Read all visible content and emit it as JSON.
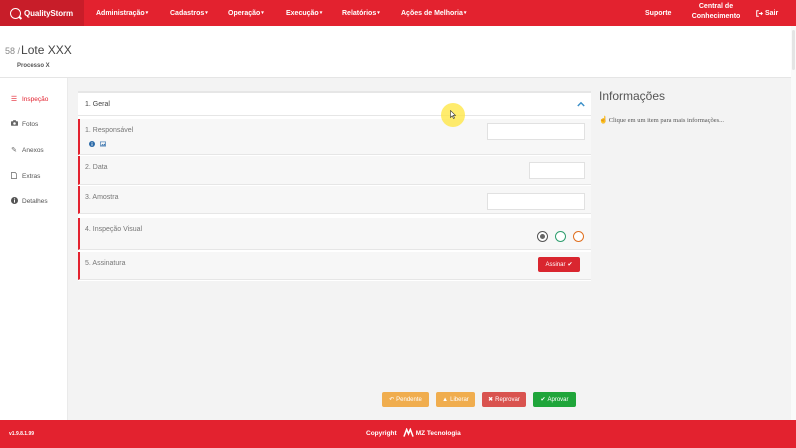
{
  "brand": {
    "name": "QualityStorm"
  },
  "nav": {
    "items": [
      {
        "label": "Administração"
      },
      {
        "label": "Cadastros"
      },
      {
        "label": "Operação"
      },
      {
        "label": "Execução"
      },
      {
        "label": "Relatórios"
      },
      {
        "label": "Ações de Melhoria"
      }
    ],
    "caret": "▾",
    "support": "Suporte",
    "knowledge_line1": "Central de",
    "knowledge_line2": "Conhecimento",
    "logout_icon": "sign-out-icon",
    "logout": "Sair"
  },
  "header": {
    "number": "58 /",
    "title": "Lote XXX",
    "subtitle": "Processo X"
  },
  "sidebar": {
    "items": [
      {
        "label": "Inspeção",
        "icon": "list-icon",
        "active": true
      },
      {
        "label": "Fotos",
        "icon": "camera-icon"
      },
      {
        "label": "Anexos",
        "icon": "paperclip-icon"
      },
      {
        "label": "Extras",
        "icon": "file-icon"
      },
      {
        "label": "Detalhes",
        "icon": "info-icon"
      }
    ]
  },
  "section": {
    "title": "1. Geral",
    "expanded": true
  },
  "fields": [
    {
      "label": "1. Responsável",
      "value": ""
    },
    {
      "label": "2. Data",
      "value": ""
    },
    {
      "label": "3. Amostra",
      "value": ""
    },
    {
      "label": "4. Inspeção Visual",
      "options": [
        "#555555",
        "#2e9e6e",
        "#e07020"
      ],
      "selected_index": 0
    },
    {
      "label": "5. Assinatura",
      "button": "Assinar"
    }
  ],
  "info": {
    "title": "Informações",
    "hint": "Clique em um item para mais informações..."
  },
  "actions": {
    "pending": "Pendente",
    "release": "Liberar",
    "reject": "Reprovar",
    "approve": "Aprovar"
  },
  "footer": {
    "version": "v1.9.8.1.99",
    "copyright": "Copyright",
    "company": "MZ Tecnologia"
  },
  "colors": {
    "primary": "#e3222f",
    "pending": "#f0ad4e",
    "reject": "#d9534f",
    "approve": "#1fa53a"
  }
}
